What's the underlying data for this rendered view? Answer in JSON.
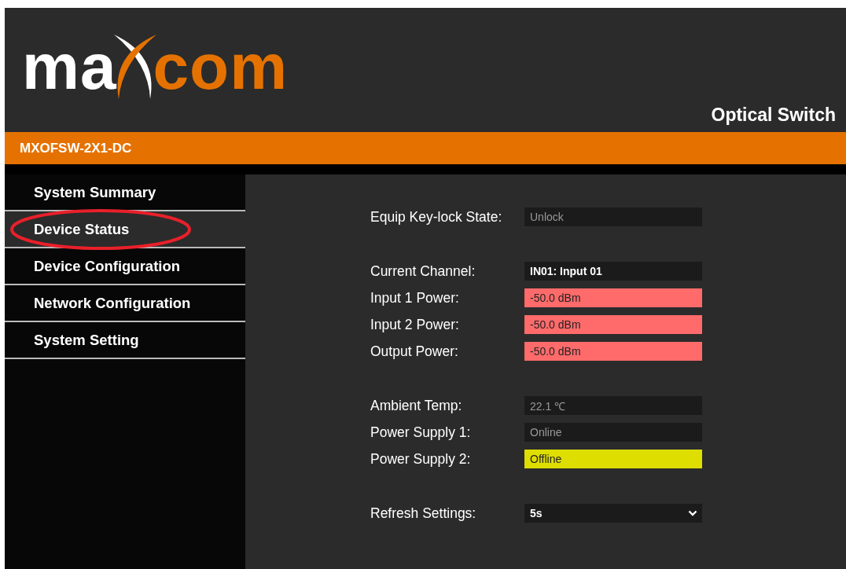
{
  "logo": {
    "left": "ma",
    "right": "com"
  },
  "header": {
    "title": "Optical Switch"
  },
  "model_bar": {
    "model": "MXOFSW-2X1-DC"
  },
  "sidebar": {
    "items": [
      {
        "label": "System Summary",
        "selected": false
      },
      {
        "label": "Device Status",
        "selected": true,
        "circled": true
      },
      {
        "label": "Device Configuration",
        "selected": false
      },
      {
        "label": "Network Configuration",
        "selected": false
      },
      {
        "label": "System Setting",
        "selected": false
      }
    ]
  },
  "groups": [
    {
      "rows": [
        {
          "label": "Equip Key-lock State:",
          "value": "Unlock",
          "kind": "readonly"
        }
      ]
    },
    {
      "rows": [
        {
          "label": "Current Channel:",
          "value": "IN01: Input 01",
          "kind": "value"
        },
        {
          "label": "Input 1 Power:",
          "value": "-50.0 dBm",
          "kind": "alarm"
        },
        {
          "label": "Input 2 Power:",
          "value": "-50.0 dBm",
          "kind": "alarm"
        },
        {
          "label": "Output Power:",
          "value": "-50.0 dBm",
          "kind": "alarm"
        }
      ]
    },
    {
      "rows": [
        {
          "label": "Ambient Temp:",
          "value": "22.1 ℃",
          "kind": "readonly"
        },
        {
          "label": "Power Supply 1:",
          "value": "Online",
          "kind": "readonly"
        },
        {
          "label": "Power Supply 2:",
          "value": "Offline",
          "kind": "warning"
        }
      ]
    },
    {
      "rows": [
        {
          "label": "Refresh Settings:",
          "value": "5s",
          "kind": "select"
        }
      ]
    }
  ]
}
